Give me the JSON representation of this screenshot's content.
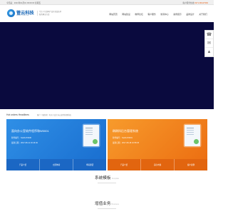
{
  "topbar": {
    "left": "今天是：2021年01月01 09:00:00 星期五",
    "right_prefix": "客户服务热线 ",
    "right_tel": "0371-86447966"
  },
  "header": {
    "logo_text": "管云科技",
    "logo_sub": "WWW.CYUN.COM",
    "slogan": "专注于互联网产品开发及技术服务解决方案",
    "nav": [
      "网站首页",
      "网站建设",
      "教师论坛",
      "客户服务",
      "新闻中心",
      "案例展示",
      "品牌设计",
      "关于我们"
    ]
  },
  "side_float": [
    "☎",
    "✉",
    "▲"
  ],
  "breadcrumb": {
    "title": "Hot orders Headlines",
    "path": "客户 > 服务管 : 有关于会计办公软件管理系统"
  },
  "cards": [
    {
      "title": "面向办公室软件程序和W0001",
      "meta1": "软件编号：Su9A170330",
      "meta2": "最新日期：2017-08-11 16:16:49",
      "actions": [
        "产品介绍",
        "立即体验",
        "申请通话"
      ]
    },
    {
      "title": "刷刷科后台管理系统",
      "meta1": "软件编号：Su9A170001",
      "meta2": "最新日期：2017-08-18 16:58:45",
      "actions": [
        "产品介绍",
        "演示内容",
        "客户案例"
      ]
    }
  ],
  "sections": [
    {
      "cn": "系统模板",
      "en": "Template"
    },
    {
      "cn": "增值业务",
      "en": "Business"
    }
  ],
  "colors": {
    "hero": "#0a0a3e",
    "blue_card": "#2f8fe6",
    "orange_card": "#f79b2c"
  }
}
